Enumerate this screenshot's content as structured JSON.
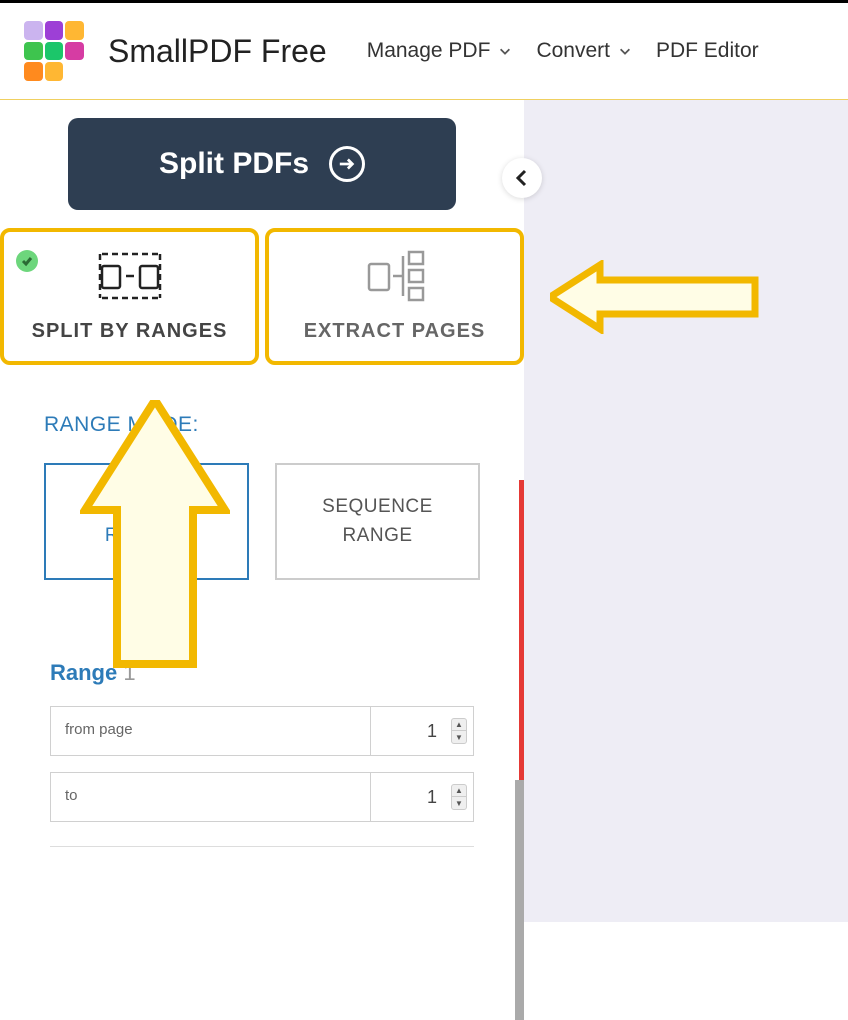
{
  "brand": "SmallPDF Free",
  "nav": {
    "manage": "Manage PDF",
    "convert": "Convert",
    "editor": "PDF Editor"
  },
  "split_button": "Split PDFs",
  "tabs": {
    "split_ranges": "SPLIT BY RANGES",
    "extract_pages": "EXTRACT PAGES"
  },
  "range_section": {
    "title": "RANGE MODE:",
    "personal": "PERSONAL RANGES",
    "sequence": "SEQUENCE RANGE"
  },
  "range1": {
    "title_prefix": "Range ",
    "title_num": "1",
    "from_label": "from page",
    "from_value": "1",
    "to_label": "to",
    "to_value": "1"
  },
  "logo_colors": [
    "#cbb4ef",
    "#9d3fd6",
    "#ffb733",
    "#3ec44e",
    "#1cc66a",
    "#d63ca3",
    "#ff8a1e",
    "#ffb733",
    "#fff"
  ]
}
